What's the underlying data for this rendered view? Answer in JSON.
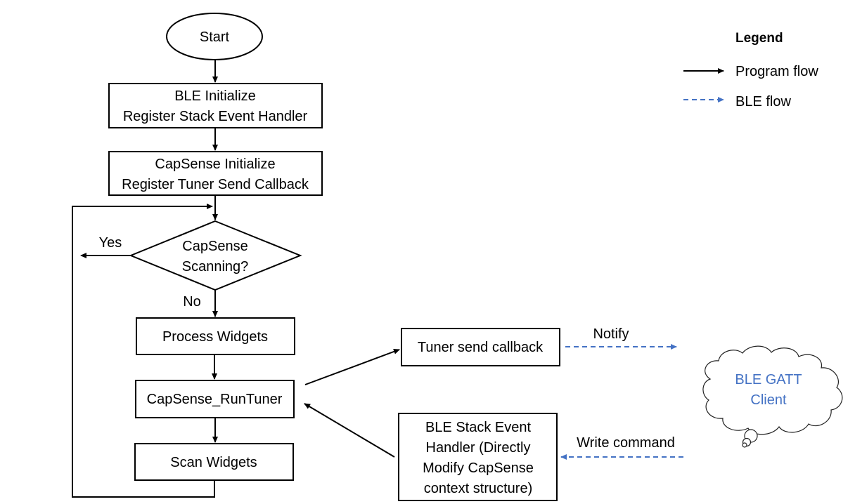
{
  "nodes": {
    "start": "Start",
    "ble_init": [
      "BLE Initialize",
      "Register Stack Event Handler"
    ],
    "capsense_init": [
      "CapSense Initialize",
      "Register Tuner Send Callback"
    ],
    "decision": [
      "CapSense",
      "Scanning?"
    ],
    "process_widgets": "Process Widgets",
    "run_tuner": "CapSense_RunTuner",
    "scan_widgets": "Scan Widgets",
    "tuner_send_callback": "Tuner send callback",
    "ble_stack_handler": [
      "BLE Stack Event",
      "Handler (Directly",
      "Modify CapSense",
      "context structure)"
    ],
    "gatt_client": [
      "BLE GATT",
      "Client"
    ]
  },
  "edge_labels": {
    "yes": "Yes",
    "no": "No",
    "notify": "Notify",
    "write_command": "Write command"
  },
  "legend": {
    "title": "Legend",
    "program_flow": "Program flow",
    "ble_flow": "BLE flow"
  },
  "colors": {
    "program_flow": "#000000",
    "ble_flow": "#4472c4"
  }
}
